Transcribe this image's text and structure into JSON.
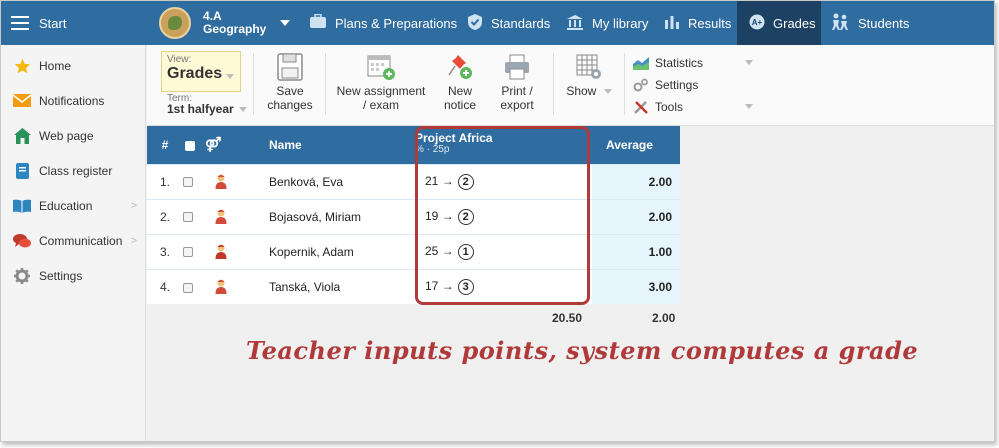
{
  "topbar": {
    "start_label": "Start",
    "class_name": "4.A",
    "subject": "Geography",
    "nav": [
      {
        "label": "Plans & Preparations",
        "icon": "briefcase-icon"
      },
      {
        "label": "Standards",
        "icon": "shield-check-icon"
      },
      {
        "label": "My library",
        "icon": "library-icon"
      },
      {
        "label": "Results",
        "icon": "bar-chart-icon"
      },
      {
        "label": "Grades",
        "icon": "grades-icon",
        "active": true
      },
      {
        "label": "Students",
        "icon": "students-icon"
      }
    ]
  },
  "sidebar": {
    "items": [
      {
        "label": "Home",
        "icon": "star-icon"
      },
      {
        "label": "Notifications",
        "icon": "envelope-icon"
      },
      {
        "label": "Web page",
        "icon": "house-icon"
      },
      {
        "label": "Class register",
        "icon": "register-icon"
      },
      {
        "label": "Education",
        "icon": "book-icon",
        "has_submenu": true
      },
      {
        "label": "Communication",
        "icon": "chat-icon",
        "has_submenu": true
      },
      {
        "label": "Settings",
        "icon": "gear-icon"
      }
    ]
  },
  "toolbar": {
    "view_label": "View:",
    "view_value": "Grades",
    "term_label": "Term:",
    "term_value": "1st halfyear",
    "save_label_1": "Save",
    "save_label_2": "changes",
    "new_assignment_1": "New assignment",
    "new_assignment_2": "/ exam",
    "new_notice_1": "New",
    "new_notice_2": "notice",
    "print_1": "Print /",
    "print_2": "export",
    "show_label": "Show",
    "statistics_label": "Statistics",
    "settings_label": "Settings",
    "tools_label": "Tools"
  },
  "table": {
    "col_num": "#",
    "col_name": "Name",
    "assignment_title": "Project Africa",
    "assignment_sub": "% · 25p",
    "col_average": "Average",
    "arrow": "→",
    "rows": [
      {
        "num": "1.",
        "name": "Benková, Eva",
        "points": "21",
        "grade": "2",
        "average": "2.00",
        "avatar_color": "#d24a3a"
      },
      {
        "num": "2.",
        "name": "Bojasová, Miriam",
        "points": "19",
        "grade": "2",
        "average": "2.00",
        "avatar_color": "#d24a3a"
      },
      {
        "num": "3.",
        "name": "Kopernik, Adam",
        "points": "25",
        "grade": "1",
        "average": "1.00",
        "avatar_color": "#c0392b"
      },
      {
        "num": "4.",
        "name": "Tanská, Viola",
        "points": "17",
        "grade": "3",
        "average": "3.00",
        "avatar_color": "#d24a3a"
      }
    ],
    "total_points_avg": "20.50",
    "total_grade_avg": "2.00"
  },
  "annotation": "Teacher inputs points, system computes a grade",
  "colors": {
    "header": "#2f6c9f",
    "active_nav": "#1d4163",
    "highlight": "#b03a3a",
    "average_bg": "#e6f4fb"
  }
}
